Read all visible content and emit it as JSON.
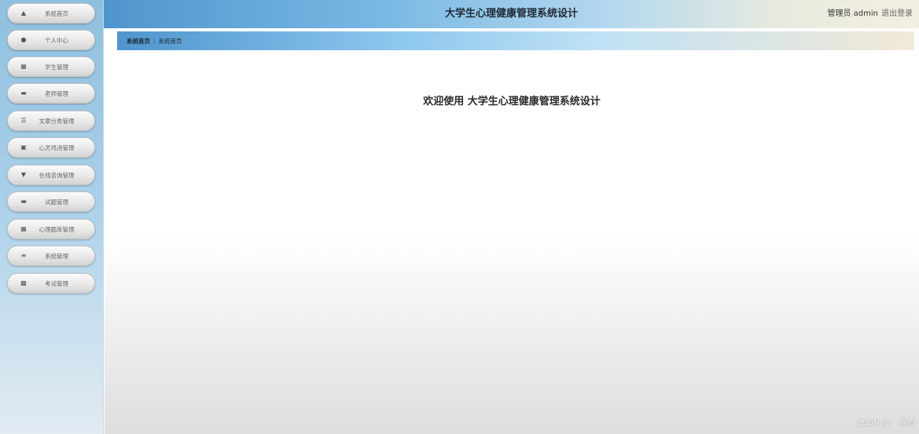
{
  "header": {
    "title": "大学生心理健康管理系统设计",
    "user_label": "管理员 admin",
    "logout_label": "退出登录"
  },
  "breadcrumb": {
    "home": "系统首页",
    "separator": "⁝",
    "current": "系统首页"
  },
  "sidebar": {
    "items": [
      {
        "label": "系统首页",
        "icon": "home-icon"
      },
      {
        "label": "个人中心",
        "icon": "user-icon"
      },
      {
        "label": "学生管理",
        "icon": "grid-icon"
      },
      {
        "label": "老师管理",
        "icon": "monitor-icon"
      },
      {
        "label": "文章分类管理",
        "icon": "sliders-icon"
      },
      {
        "label": "心灵鸡汤管理",
        "icon": "clipboard-icon"
      },
      {
        "label": "在线咨询管理",
        "icon": "chat-icon"
      },
      {
        "label": "试题管理",
        "icon": "monitor-icon"
      },
      {
        "label": "心理题库管理",
        "icon": "grid-icon"
      },
      {
        "label": "系统管理",
        "icon": "list-icon"
      },
      {
        "label": "考试管理",
        "icon": "exam-icon"
      }
    ]
  },
  "main": {
    "welcome": "欢迎使用 大学生心理健康管理系统设计"
  },
  "watermark": "CSDN @ ゛黑白",
  "colors": {
    "topbar_start": "#4f95cd",
    "topbar_end": "#f3efe0",
    "sidebar_bg": "#a9d0ea"
  }
}
